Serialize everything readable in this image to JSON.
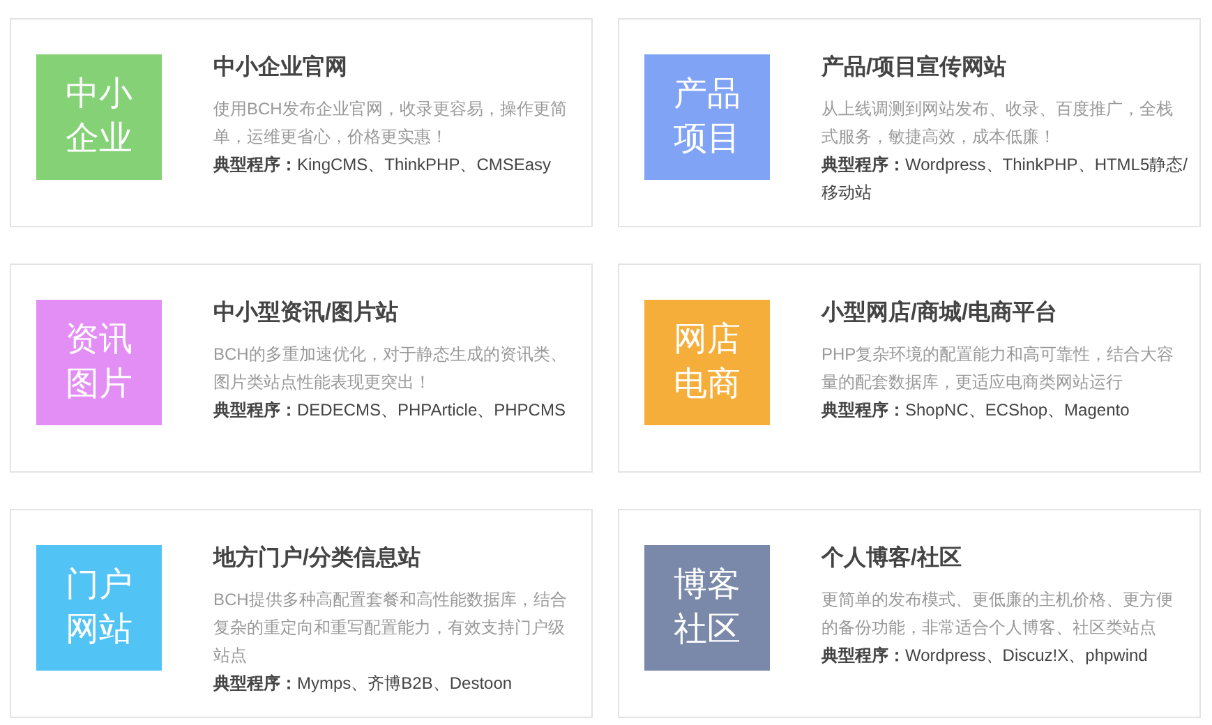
{
  "cards": [
    {
      "tile": "中小企业",
      "color": "#84d176",
      "title": "中小企业官网",
      "description": "使用BCH发布企业官网，收录更容易，操作更简单，运维更省心，价格更实惠！",
      "programs": "**典型程序：**KingCMS、ThinkPHP、CMSEasy"
    },
    {
      "tile": "产品项目",
      "color": "#81a3f6",
      "title": "产品/项目宣传网站",
      "description": "从上线调测到网站发布、收录、百度推广，全栈式服务，敏捷高效，成本低廉！",
      "programs": "**典型程序：**Wordpress、ThinkPHP、HTML5静态/移动站"
    },
    {
      "tile": "资讯图片",
      "color": "#e38ef5",
      "title": "中小型资讯/图片站",
      "description": "BCH的多重加速优化，对于静态生成的资讯类、图片类站点性能表现更突出！",
      "programs": "**典型程序：**DEDECMS、PHPArticle、PHPCMS"
    },
    {
      "tile": "网店电商",
      "color": "#f6ae3b",
      "title": "小型网店/商城/电商平台",
      "description": "PHP复杂环境的配置能力和高可靠性，结合大容量的配套数据库，更适应电商类网站运行",
      "programs": "**典型程序：**ShopNC、ECShop、Magento"
    },
    {
      "tile": "门户网站",
      "color": "#52c3f5",
      "title": "地方门户/分类信息站",
      "description": "BCH提供多种高配置套餐和高性能数据库，结合复杂的重定向和重写配置能力，有效支持门户级站点",
      "programs": "**典型程序：**Mymps、齐博B2B、Destoon"
    },
    {
      "tile": "博客社区",
      "color": "#7a89a9",
      "title": "个人博客/社区",
      "description": "更简单的发布模式、更低廉的主机价格、更方便的备份功能，非常适合个人博客、社区类站点",
      "programs": "**典型程序：**Wordpress、Discuz!X、phpwind"
    }
  ]
}
